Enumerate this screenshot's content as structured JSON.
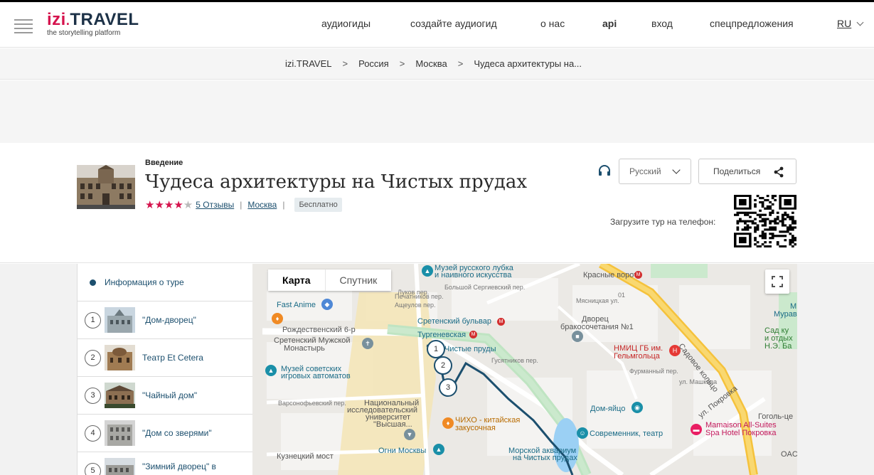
{
  "logo": {
    "izi": "izi",
    "dot": ".",
    "travel": "TRAVEL",
    "tagline": "the storytelling platform"
  },
  "nav": {
    "items": [
      {
        "label": "аудиогиды"
      },
      {
        "label": "создайте аудиогид"
      },
      {
        "label": "о нас"
      },
      {
        "label": "api"
      },
      {
        "label": "вход"
      },
      {
        "label": "спецпредложения"
      }
    ],
    "language": "RU"
  },
  "breadcrumb": [
    "izi.TRAVEL",
    "Россия",
    "Москва",
    "Чудеса архитектуры на..."
  ],
  "breadcrumb_sep": ">",
  "tour": {
    "eyebrow": "Введение",
    "title": "Чудеса архитектуры на Чистых прудах",
    "rating_stars": "★★★★",
    "rating_off": "★",
    "rating": 4,
    "reviews_link": "5 Отзывы",
    "city_link": "Москва",
    "sep": "|",
    "price_badge": "Бесплатно",
    "language_select": "Русский",
    "share_label": "Поделиться",
    "qr_label": "Загрузите тур на телефон:"
  },
  "sidebar": {
    "info_label": "Информация о туре",
    "items": [
      {
        "num": "1",
        "label": "\"Дом-дворец\""
      },
      {
        "num": "2",
        "label": "Театр Et Cetera"
      },
      {
        "num": "3",
        "label": "\"Чайный дом\""
      },
      {
        "num": "4",
        "label": "\"Дом со зверями\""
      },
      {
        "num": "5",
        "label": "\"Зимний дворец\" в"
      }
    ]
  },
  "map": {
    "tabs": [
      "Карта",
      "Спутник"
    ],
    "stops": [
      "1",
      "2",
      "3"
    ],
    "labels": {
      "museum_lubok": "Музей русского лубка",
      "museum_lubok2": "и наивного искусства",
      "krasnye_vorota": "Красные ворота",
      "fast_anime": "Fast Anime",
      "sretensky_bulvar": "Сретенский бульвар",
      "turgenevskaya": "Тургеневская",
      "chistye_prudy": "Чистые пруды",
      "rozhdestvensky": "Рождественский 6-р",
      "monastery1": "Сретенский Мужской",
      "monastery2": "Монастырь",
      "dvorets1": "Дворец",
      "dvorets2": "бракосочетания №1",
      "nmits1": "НМИЦ ГБ им.",
      "nmits2": "Гельмгольца",
      "museum_automata1": "Музей советских",
      "museum_automata2": "игровых автоматов",
      "university1": "Национальный",
      "university2": "исследовательский",
      "university3": "университет",
      "university4": "\"Высшая...",
      "chiho1": "ЧИХО - китайская",
      "chiho2": "закусочная",
      "dom_yaitso": "Дом-яйцо",
      "sovremennik": "Современник, театр",
      "ogni_moskvy": "Огни Москвы",
      "aquarium1": "Морской аквариум",
      "aquarium2": "на Чистых прудах",
      "mamaison1": "Mamaison All-Suites",
      "mamaison2": "Spa Hotel Покровка",
      "sadovoe": "Садовое кольцо",
      "pokrovka": "ул. Покровка",
      "goghol": "Гоголь-це",
      "sad1": "Сад ку",
      "sad2": "и отдых",
      "sad3": "Н.Э. Ба",
      "muravievy": "Муравьеви",
      "bolshoy_sergievsky": "Большой Сергиевский пер.",
      "pechatnikov": "Печатников пер.",
      "lukov": "Луков пер.",
      "ashcheulov": "Ащеулов пер.",
      "varsonofevsky": "Варсонофьевский пер.",
      "myasnitskaya": "Мясницкая ул.",
      "furmanny": "Фурманный пер.",
      "mashkova": "ул. Машкова",
      "gusyatnikov": "Гусятников пер.",
      "kuznetsky": "Кузнецкий мост",
      "m_letter": "М",
      "o1": "01",
      "oac": "OAC"
    }
  }
}
